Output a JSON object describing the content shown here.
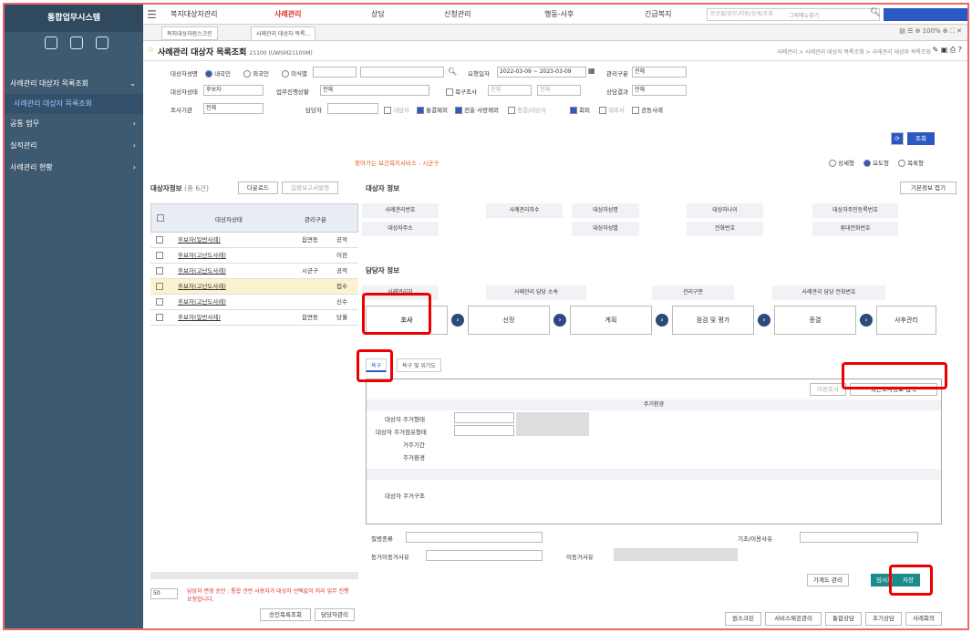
{
  "sidebar": {
    "title": "통합업무시스템",
    "items": [
      {
        "label": "사례관리 대상자 목록조회"
      },
      {
        "label": "사례관리 대상자 목록조회"
      },
      {
        "label": "공통 업무"
      },
      {
        "label": "실적관리"
      },
      {
        "label": "사례관리 현황"
      }
    ]
  },
  "topnav": {
    "menus": [
      "복지대상자관리",
      "사례관리",
      "상담",
      "신청관리",
      "행동-사후",
      "긴급복지"
    ],
    "search_placeholder": "프로필/업무/지원/상세/조회",
    "dropdown": "그외메뉴찾기"
  },
  "tabs": [
    "복지대상자원스크린",
    "사례관리 대상자 목록..."
  ],
  "page": {
    "title": "사례관리 대상자 목록조회",
    "code": "21100 (UWSM21100M)",
    "breadcrumb": "사례관리 > 사례관리 대상자 목록조회 > 사례관리 대상자 목록조회"
  },
  "filter": {
    "row1": {
      "label_name": "대상자성명",
      "radio_domestic": "내국인",
      "radio_foreign": "외국인",
      "radio_unknown": "미식별",
      "label_period": "요청일자",
      "period_value": "2022-03-09 ~ 2023-03-09",
      "label_mgmt": "관리구분",
      "mgmt_value": "전체"
    },
    "row2": {
      "label_status": "대상자상태",
      "status_value": "후보자",
      "label_progress": "업무진행상황",
      "progress_value": "전체",
      "label_resurvey": "복구조사",
      "resurvey_v1": "전체",
      "resurvey_v2": "전체",
      "label_result": "상담결과",
      "result_value": "전체"
    },
    "row3": {
      "label_org": "조사기관",
      "org_value": "전체",
      "label_manager": "담당자",
      "chk1": "내담자",
      "chk2": "통결제외",
      "chk3": "전출·사망제외",
      "chk4": "종결/대상자",
      "chk5": "회피",
      "chk6": "재조사",
      "chk7": "공동사례"
    },
    "search_button": "조회",
    "notice": "찾아가는 보건복지서비스 - 시군구",
    "view_options": [
      "상세형",
      "요도형",
      "목록형"
    ]
  },
  "left": {
    "title": "대상자정보",
    "count": "(총 6건)",
    "download_button": "다운로드",
    "batch_button": "일괄보고서발행",
    "columns": [
      "대상자상태",
      "관리구분"
    ],
    "rows": [
      {
        "name": "후보자(일반사례)",
        "mgmt": "읍면동",
        "extra": "공적"
      },
      {
        "name": "후보자(고난도사례)",
        "mgmt": "",
        "extra": "이전"
      },
      {
        "name": "후보자(고난도사례)",
        "mgmt": "시군구",
        "extra": "공적"
      },
      {
        "name": "후보자(고난도사례)",
        "mgmt": "",
        "extra": "접수"
      },
      {
        "name": "후보자(고난도사례)",
        "mgmt": "",
        "extra": "신수"
      },
      {
        "name": "후보자(일반사례)",
        "mgmt": "읍면동",
        "extra": "당월"
      }
    ],
    "pager_value": "50",
    "bottom_notice": "담당자 변경 승인 : 통합 관련 사용자가 대상자 선택없이 처리 업무 진행 요청합니다.",
    "btn_approve": "승인목록조회",
    "btn_assign": "담당자관리"
  },
  "right": {
    "section1": "대상자 정보",
    "basic_button": "기본정보 접기",
    "info_labels": [
      "사례관리번호",
      "사례관리자수",
      "대상자성명",
      "대상자나이",
      "대상자주민등록번호",
      "대상자주소",
      "대상자성별",
      "전화번호",
      "휴대전화번호"
    ],
    "section2": "담당자 정보",
    "mgr_labels": [
      "사례관리자",
      "사례관리 담당 소속",
      "관리구분",
      "사례관리 담당 전화번호"
    ],
    "steps": [
      "조사",
      "선정",
      "계획",
      "점검 및 평가",
      "종결",
      "사후관리"
    ],
    "subtabs": [
      "욕구",
      "욕구 및 위기도"
    ],
    "survey_header": "주거환경",
    "btn_prev": "이전조사",
    "btn_prev_info": "최근조사정보 입력",
    "residence_rows": [
      "대상자 주거형태",
      "대상자 주거점유형태",
      "거주기간",
      "주거환경"
    ],
    "facility_label": "대상자 주거구조",
    "lower_labels": [
      "질병종류",
      "기초/이용사유",
      "동거이동거사유",
      "이동거사유"
    ],
    "btn_temp": "가계도 관리",
    "btn_interim": "임시저장",
    "btn_save": "저장"
  },
  "footer_buttons": [
    "원스크린",
    "서비스제공관리",
    "통합상담",
    "초기상담",
    "사례회의"
  ]
}
